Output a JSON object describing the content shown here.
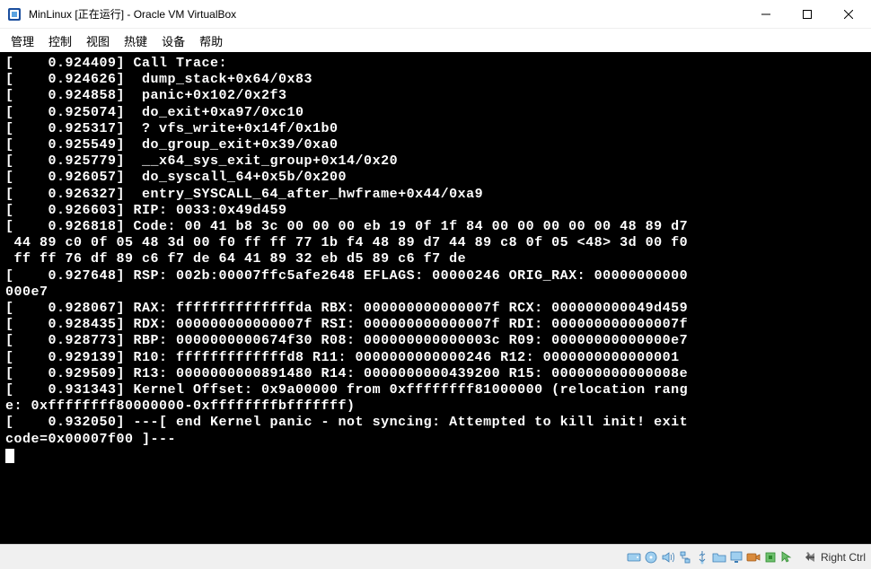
{
  "window": {
    "title": "MinLinux [正在运行] - Oracle VM VirtualBox"
  },
  "menu": {
    "manage": "管理",
    "control": "控制",
    "view": "视图",
    "hotkeys": "热键",
    "devices": "设备",
    "help": "帮助"
  },
  "terminal_lines": [
    "[    0.924409] Call Trace:",
    "[    0.924626]  dump_stack+0x64/0x83",
    "[    0.924858]  panic+0x102/0x2f3",
    "[    0.925074]  do_exit+0xa97/0xc10",
    "[    0.925317]  ? vfs_write+0x14f/0x1b0",
    "[    0.925549]  do_group_exit+0x39/0xa0",
    "[    0.925779]  __x64_sys_exit_group+0x14/0x20",
    "[    0.926057]  do_syscall_64+0x5b/0x200",
    "[    0.926327]  entry_SYSCALL_64_after_hwframe+0x44/0xa9",
    "[    0.926603] RIP: 0033:0x49d459",
    "[    0.926818] Code: 00 41 b8 3c 00 00 00 eb 19 0f 1f 84 00 00 00 00 00 48 89 d7",
    " 44 89 c0 0f 05 48 3d 00 f0 ff ff 77 1b f4 48 89 d7 44 89 c8 0f 05 <48> 3d 00 f0",
    " ff ff 76 df 89 c6 f7 de 64 41 89 32 eb d5 89 c6 f7 de",
    "[    0.927648] RSP: 002b:00007ffc5afe2648 EFLAGS: 00000246 ORIG_RAX: 00000000000",
    "000e7",
    "[    0.928067] RAX: ffffffffffffffda RBX: 000000000000007f RCX: 000000000049d459",
    "[    0.928435] RDX: 000000000000007f RSI: 000000000000007f RDI: 000000000000007f",
    "[    0.928773] RBP: 0000000000674f30 R08: 000000000000003c R09: 00000000000000e7",
    "[    0.929139] R10: fffffffffffffd8 R11: 0000000000000246 R12: 0000000000000001",
    "[    0.929509] R13: 0000000000891480 R14: 0000000000439200 R15: 000000000000008e",
    "[    0.931343] Kernel Offset: 0x9a00000 from 0xffffffff81000000 (relocation rang",
    "e: 0xffffffff80000000-0xffffffffbfffffff)",
    "[    0.932050] ---[ end Kernel panic - not syncing: Attempted to kill init! exit",
    "code=0x00007f00 ]---"
  ],
  "statusbar": {
    "host_key": "Right Ctrl"
  }
}
